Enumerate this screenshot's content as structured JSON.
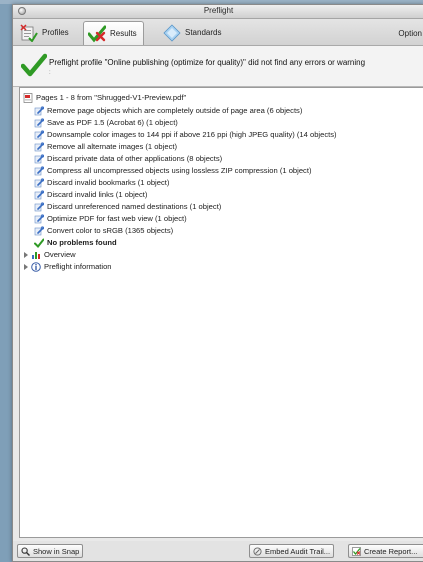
{
  "window": {
    "title": "Preflight"
  },
  "tabs": [
    {
      "label": "Profiles",
      "icon": "profiles-icon",
      "selected": false
    },
    {
      "label": "Results",
      "icon": "results-check-icon",
      "selected": true
    },
    {
      "label": "Standards",
      "icon": "standards-icon",
      "selected": false
    }
  ],
  "toolbar": {
    "options_label": "Option"
  },
  "status": {
    "message": "Preflight profile \"Online publishing (optimize for quality)\" did not find any errors or warning",
    "sub": ":"
  },
  "tree": {
    "root_label": "Pages 1 - 8 from \"Shrugged-V1-Preview.pdf\"",
    "fixups": [
      "Remove page objects which are completely outside of page area (6 objects)",
      "Save as PDF 1.5 (Acrobat 6) (1 object)",
      "Downsample color images to 144 ppi if above 216 ppi (high JPEG quality) (14 objects)",
      "Remove all alternate images (1 object)",
      "Discard private data of other applications (8 objects)",
      "Compress all uncompressed objects using lossless ZIP compression (1 object)",
      "Discard invalid bookmarks (1 object)",
      "Discard invalid links (1 object)",
      "Discard unreferenced named destinations (1 object)",
      "Optimize PDF for fast web view (1 object)",
      "Convert color to sRGB (1365 objects)"
    ],
    "no_problems_label": "No problems found",
    "overview_label": "Overview",
    "preflight_info_label": "Preflight information"
  },
  "bottom": {
    "show_in_snap_label": "Show in Snap",
    "embed_audit_trail_label": "Embed Audit Trail...",
    "create_report_label": "Create Report..."
  },
  "colors": {
    "check_green": "#2f9a25",
    "error_red": "#d42a2a",
    "fixup_blue": "#3b6fc4"
  }
}
